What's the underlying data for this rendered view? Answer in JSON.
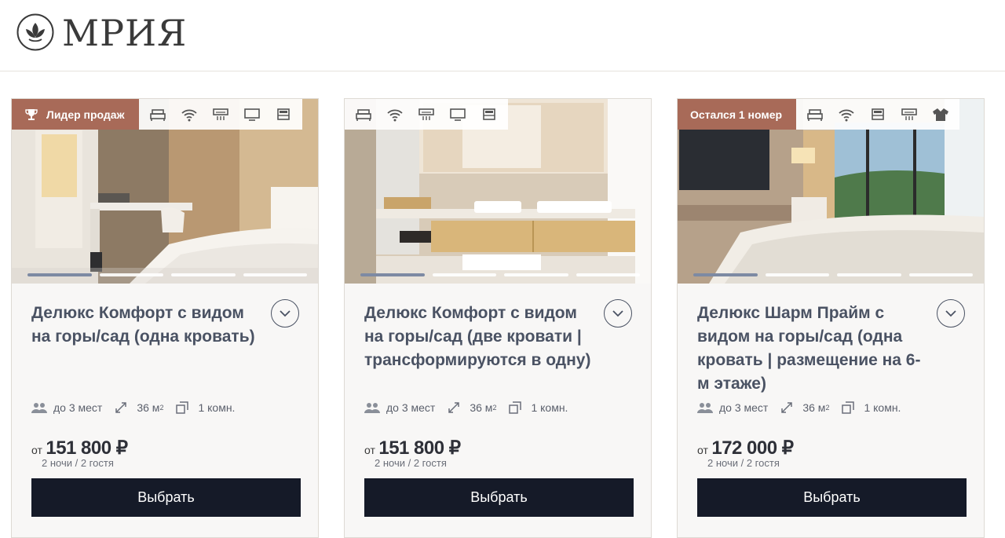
{
  "header": {
    "logo_text": "МРИЯ"
  },
  "colors": {
    "button_bg": "#151a28",
    "badge_bg": "#a86a58",
    "title_text": "#4a5263"
  },
  "cards": [
    {
      "badge": "Лидер продаж",
      "badge_icon": "trophy-icon",
      "amenities": [
        "bed-icon",
        "wifi-icon",
        "air-conditioner-icon",
        "tv-icon",
        "single-bed-icon"
      ],
      "title": "Делюкс Комфорт с видом на горы/сад (одна кровать)",
      "guests": "до 3 мест",
      "area": "36 м",
      "area_sup": "2",
      "rooms": "1 комн.",
      "price_prefix": "от",
      "price": "151 800 ₽",
      "price_note": "2 ночи / 2 гостя",
      "button": "Выбрать",
      "slides": 4,
      "active_slide": 1
    },
    {
      "badge": "",
      "amenities": [
        "bed-icon",
        "wifi-icon",
        "air-conditioner-icon",
        "tv-icon",
        "single-bed-icon"
      ],
      "title": "Делюкс Комфорт с видом на горы/сад (две кровати | трансформируются в одну)",
      "guests": "до 3 мест",
      "area": "36 м",
      "area_sup": "2",
      "rooms": "1 комн.",
      "price_prefix": "от",
      "price": "151 800 ₽",
      "price_note": "2 ночи / 2 гостя",
      "button": "Выбрать",
      "slides": 4,
      "active_slide": 1
    },
    {
      "badge": "Остался 1 номер",
      "amenities": [
        "bed-icon",
        "wifi-icon",
        "single-bed-icon",
        "air-conditioner-icon",
        "bathrobe-icon"
      ],
      "title": "Делюкс Шарм Прайм с видом на горы/сад (одна кровать | размещение на 6-м этаже)",
      "guests": "до 3 мест",
      "area": "36 м",
      "area_sup": "2",
      "rooms": "1 комн.",
      "price_prefix": "от",
      "price": "172 000 ₽",
      "price_note": "2 ночи / 2 гостя",
      "button": "Выбрать",
      "slides": 4,
      "active_slide": 1
    }
  ]
}
